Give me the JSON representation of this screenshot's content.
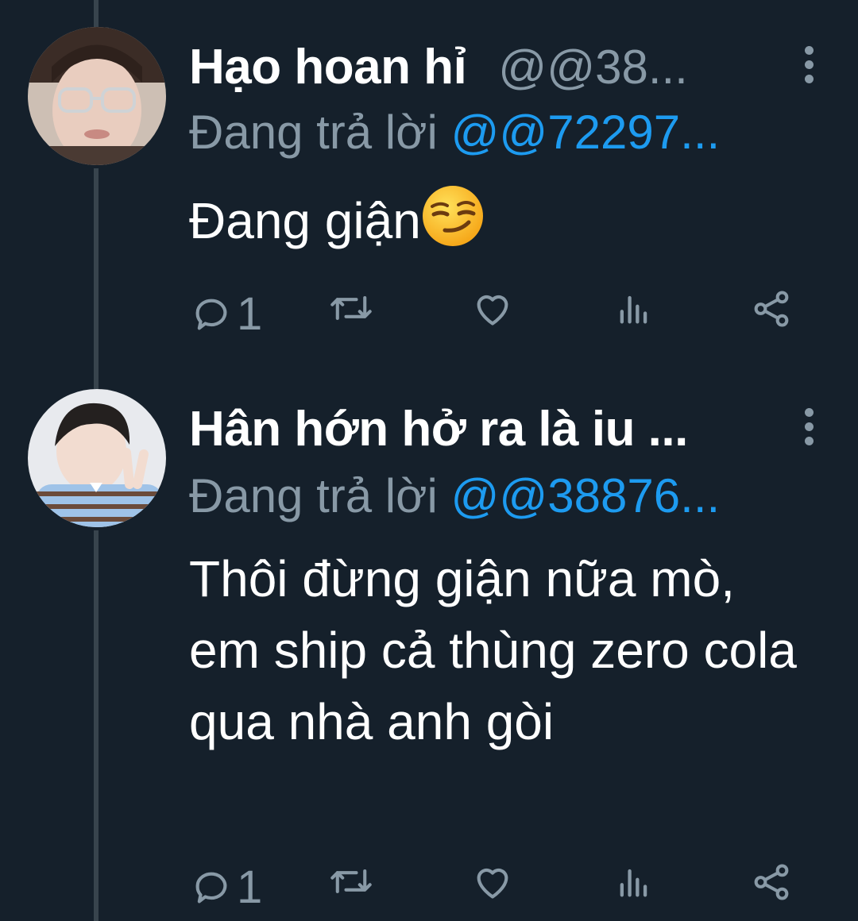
{
  "tweets": [
    {
      "display_name": "Hạo hoan hỉ",
      "handle": "@@38...",
      "reply_prefix": "Đang trả lời",
      "reply_to": "@@72297...",
      "text": "Đang giận",
      "emoji": "smirking-face",
      "reply_count": "1",
      "retweet_count": "",
      "like_count": ""
    },
    {
      "display_name": "Hân hớn hở ra là iu ...",
      "handle": "",
      "reply_prefix": "Đang trả lời",
      "reply_to": "@@38876...",
      "text": "Thôi đừng giận nữa mò, em ship cả thùng zero cola qua nhà anh gòi",
      "reply_count": "1",
      "retweet_count": "",
      "like_count": ""
    }
  ],
  "colors": {
    "background": "#15202b",
    "muted": "#8899a6",
    "link": "#1d9bf0",
    "thread_line": "#38444d"
  },
  "icons": [
    "reply-icon",
    "retweet-icon",
    "like-icon",
    "analytics-icon",
    "share-icon",
    "more-icon"
  ]
}
